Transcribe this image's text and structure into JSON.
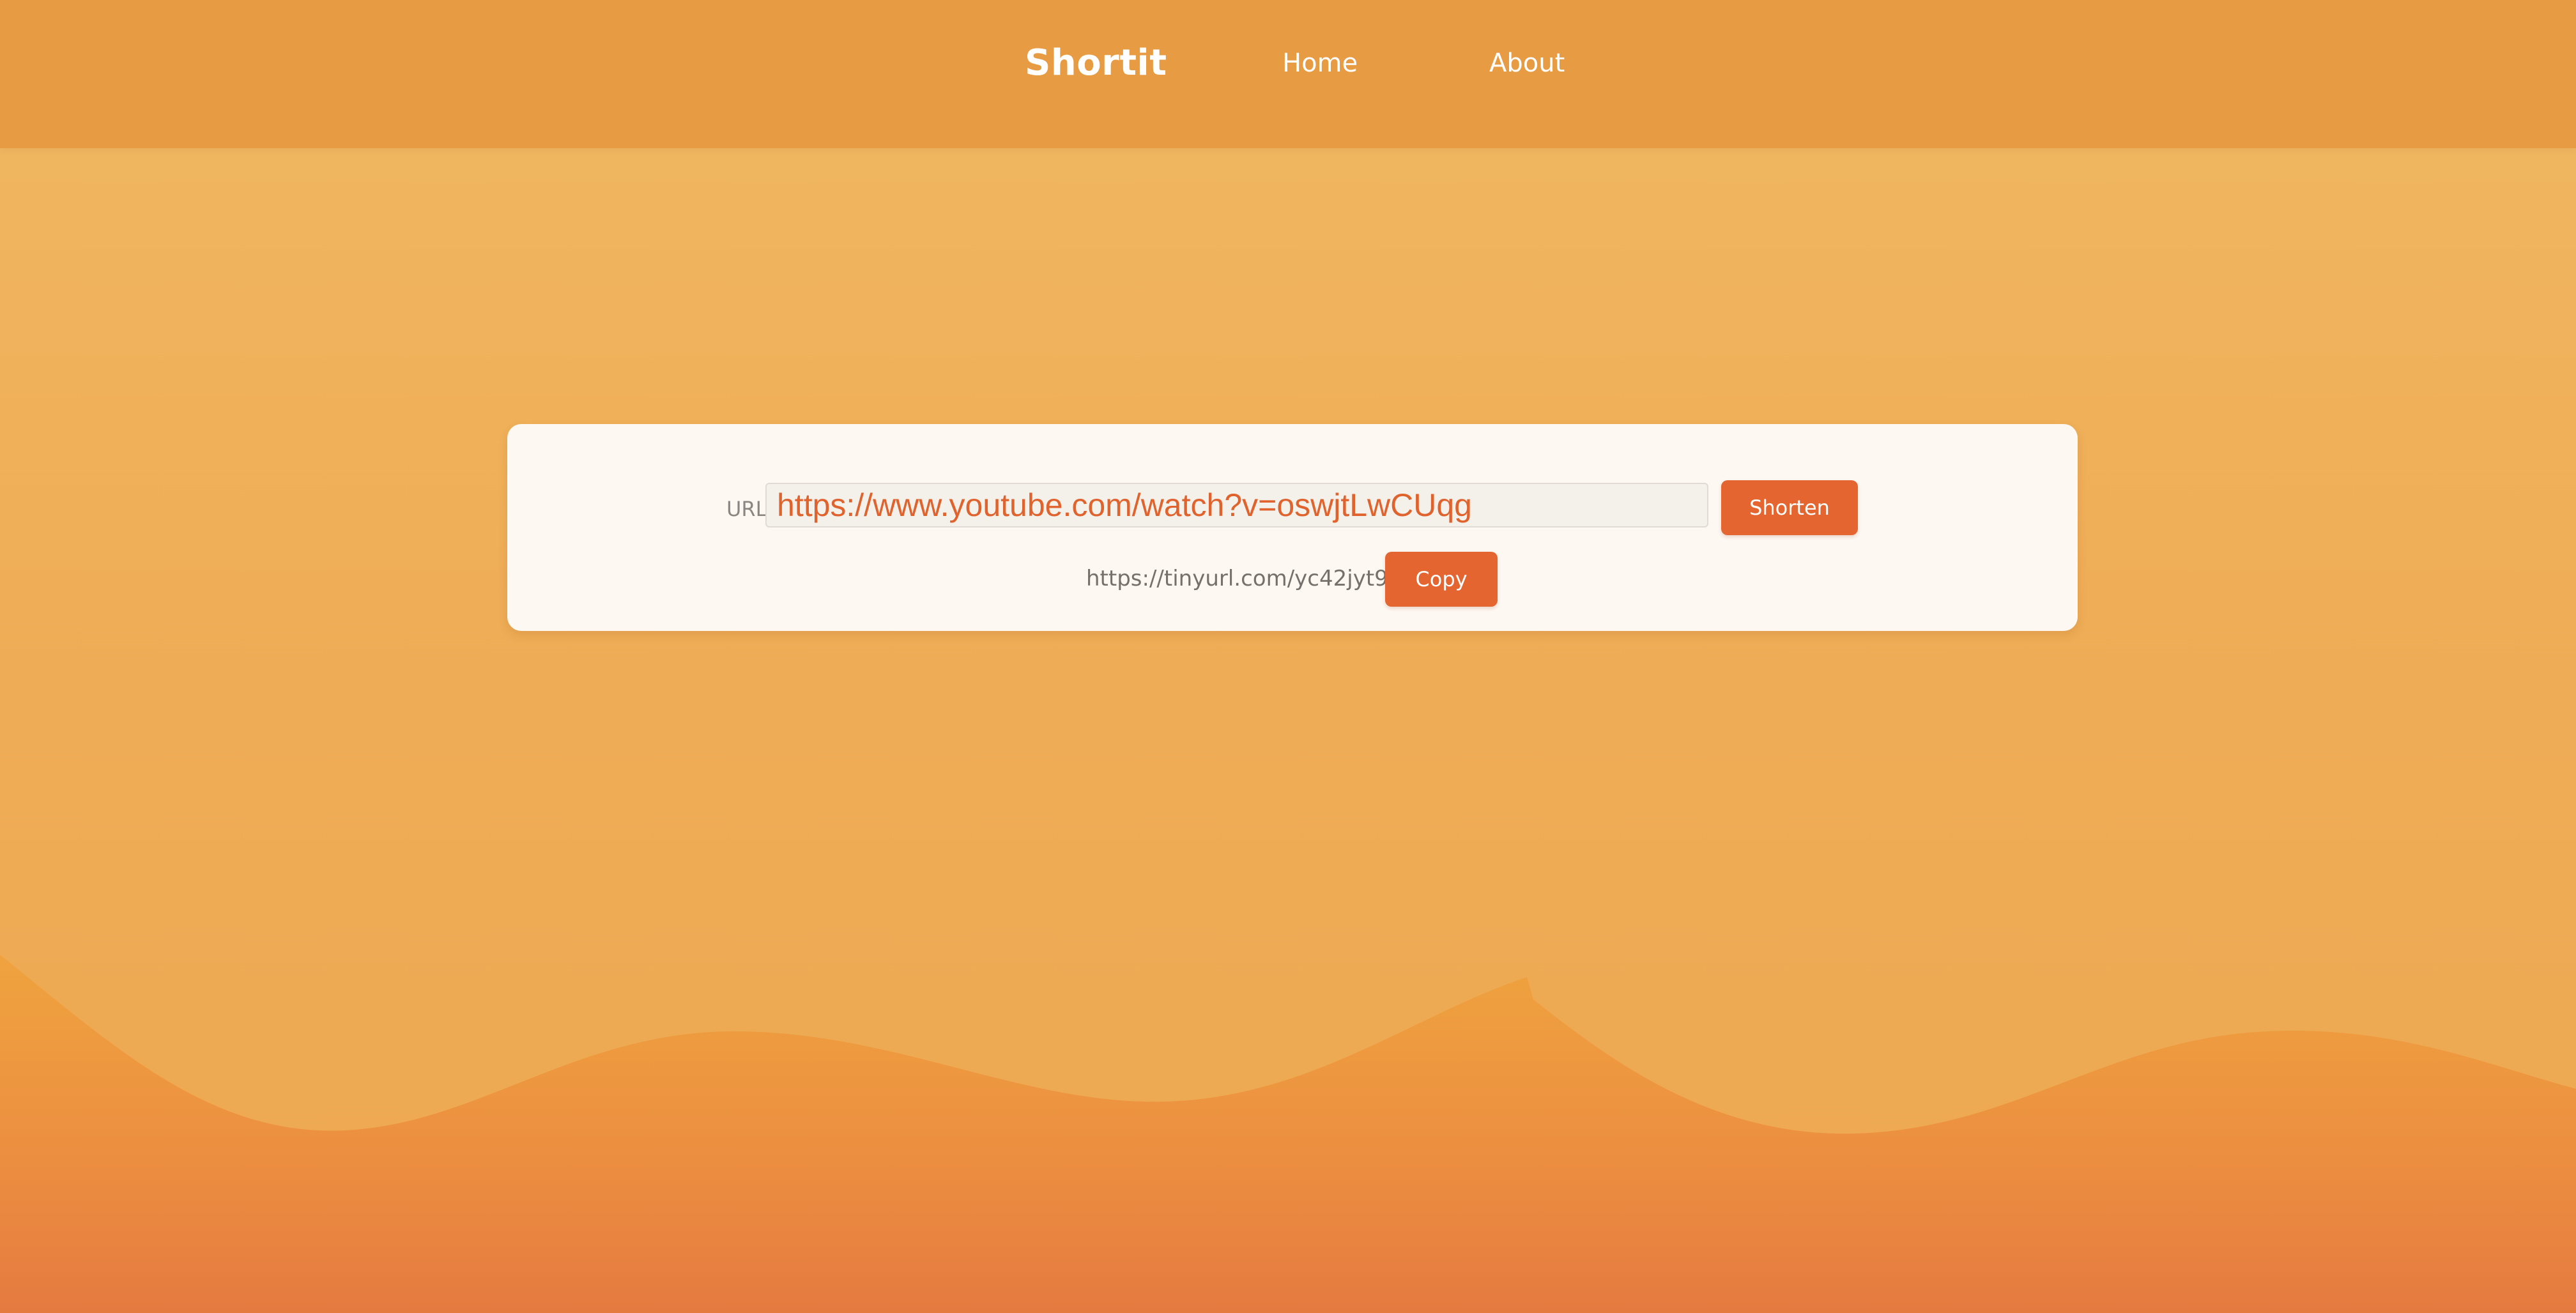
{
  "header": {
    "brand": "Shortit",
    "nav": [
      {
        "label": "Home"
      },
      {
        "label": "About"
      }
    ]
  },
  "shortener": {
    "url_label": "URL:",
    "url_value": "https://www.youtube.com/watch?v=oswjtLwCUqg",
    "shorten_label": "Shorten",
    "short_url": "https://tinyurl.com/yc42jyt9",
    "copy_label": "Copy"
  },
  "colors": {
    "header_bg": "#e79b42",
    "page_bg": "#f0b059",
    "card_bg": "#fdf8f2",
    "button": "#e46530",
    "input_text": "#e0622c",
    "wave": "#ee9a40"
  }
}
